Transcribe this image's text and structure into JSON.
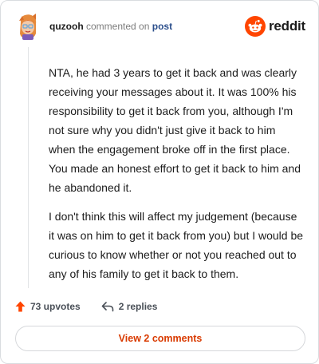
{
  "comment": {
    "username": "quzooh",
    "commented_on": "commented on",
    "post_link": "post",
    "paragraphs": [
      "NTA, he had 3 years to get it back and was clearly receiving your messages about it. It was 100% his responsibility to get it back from you, although I'm not sure why you didn't just give it back to him when the engagement broke off in the first place. You made an honest effort to get it back to him and he abandoned it.",
      "I don't think this will affect my judgement (because it was on him to get it back from you) but I would be curious to know whether or not you reached out to any of his family to get it back to them."
    ],
    "upvotes_label": "73 upvotes",
    "replies_label": "2 replies"
  },
  "brand": {
    "wordmark": "reddit",
    "color": "#ff4500"
  },
  "footer": {
    "view_comments_label": "View 2 comments"
  },
  "icons": {
    "avatar": "avatar-icon",
    "logo": "reddit-logo-icon",
    "upvote": "upvote-arrow-icon",
    "reply": "reply-arrow-icon"
  },
  "colors": {
    "accent": "#d93a00",
    "upvote": "#ff4500",
    "link": "#2c4f8c"
  }
}
